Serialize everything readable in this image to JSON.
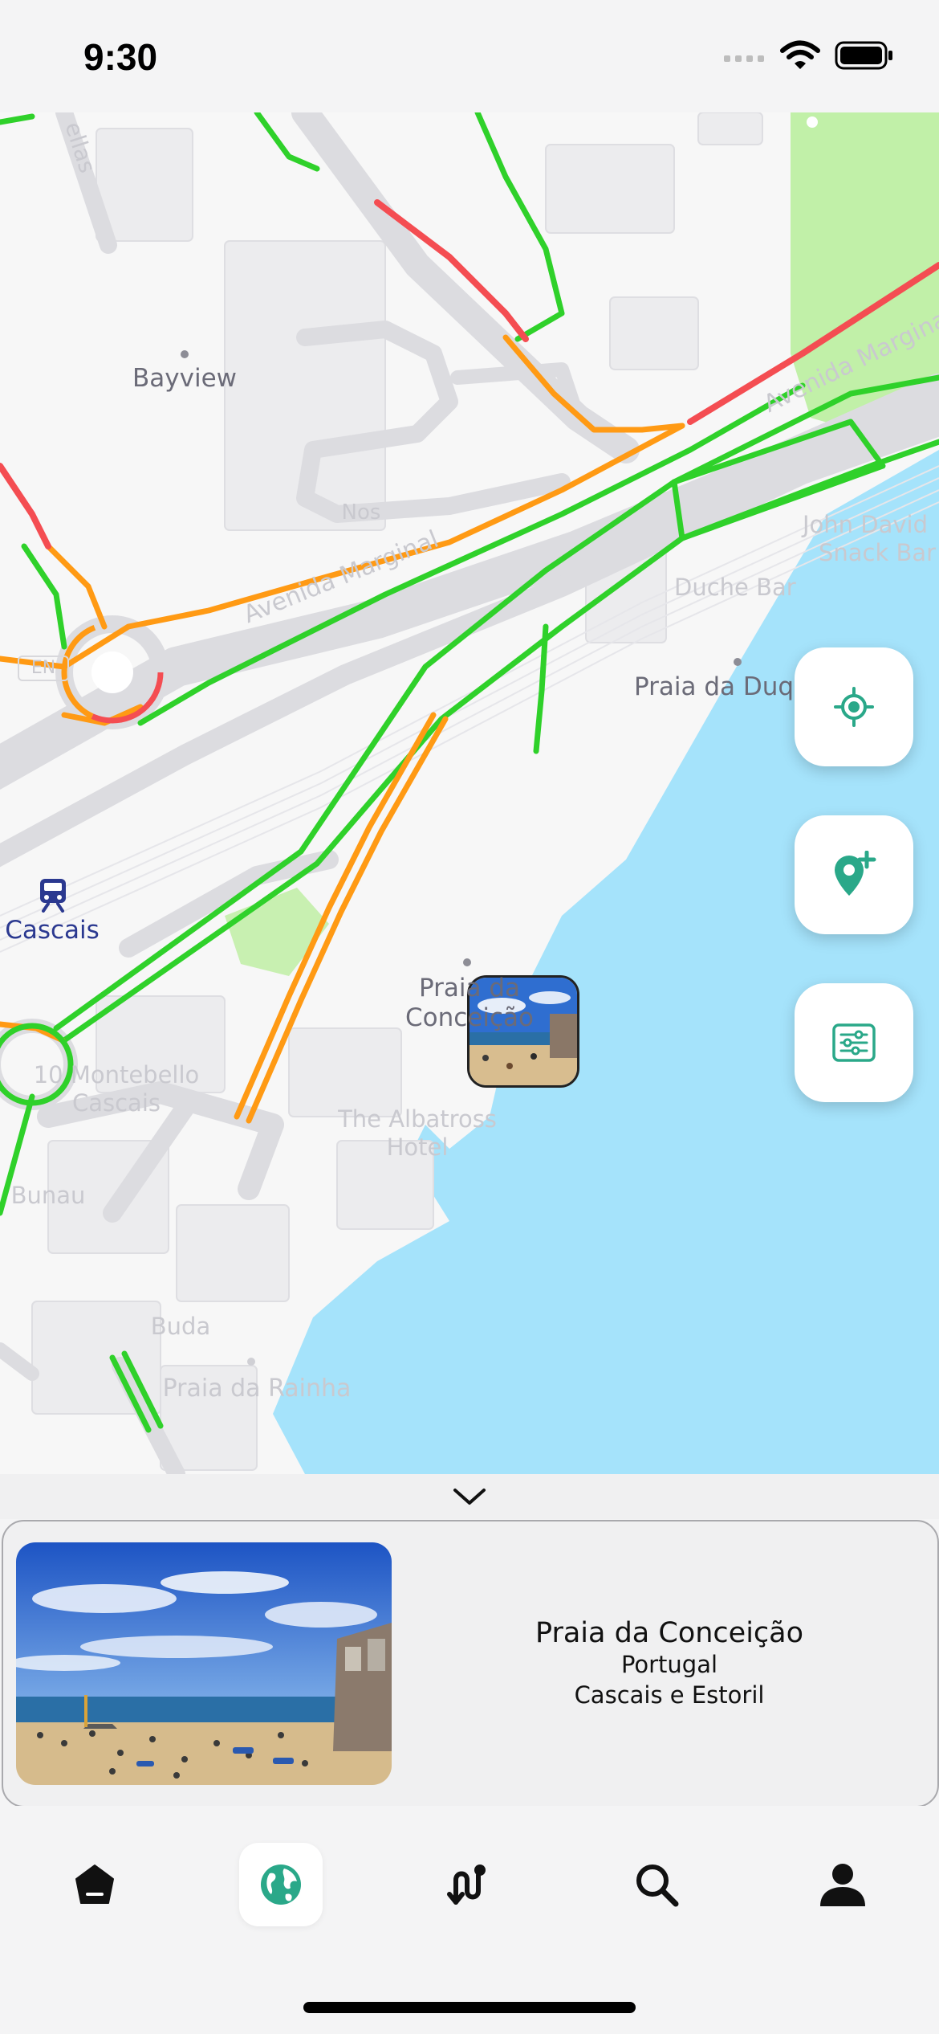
{
  "status_bar": {
    "time": "9:30"
  },
  "map": {
    "labels": {
      "bayview": "Bayview",
      "praia_duque": "Praia da Duque",
      "cascais_station": "Cascais",
      "praia_conceicao_line1": "Praia da",
      "praia_conceicao_line2": "Conceição",
      "avenida_marginal_west": "Avenida Marginal",
      "avenida_marginal_east": "Avenida Marginal",
      "john_david_line1": "John David",
      "john_david_line2": "Snack Bar",
      "duche_bar": "Duche Bar",
      "nos": "Nos",
      "en": "EN",
      "albatross_line1": "The Albatross",
      "albatross_line2": "Hotel",
      "montebello_line1": "10 Montebello",
      "montebello_line2": "Cascais",
      "bunau": "Bunau",
      "buda": "Buda",
      "praia_rainha": "Praia da Rainha",
      "ellas": "ellas"
    },
    "colors": {
      "water": "#a5e3fb",
      "park": "#c1f0a8",
      "traffic_free": "#2fd12a",
      "traffic_slow": "#ff9a14",
      "traffic_heavy": "#f44d52",
      "accent": "#2aa889"
    }
  },
  "controls": {
    "locate": {
      "icon": "locate-crosshair-icon"
    },
    "add_place": {
      "icon": "add-location-pin-icon"
    },
    "filters": {
      "icon": "filter-sliders-icon"
    }
  },
  "sheet": {
    "collapse_icon": "chevron-down-icon"
  },
  "place_card": {
    "name": "Praia da Conceição",
    "country": "Portugal",
    "region": "Cascais e Estoril"
  },
  "tab_bar": {
    "active": "globe",
    "tabs": [
      {
        "icon": "home-pentagon-icon"
      },
      {
        "icon": "globe-icon"
      },
      {
        "icon": "route-icon"
      },
      {
        "icon": "search-icon"
      },
      {
        "icon": "profile-icon"
      }
    ]
  }
}
